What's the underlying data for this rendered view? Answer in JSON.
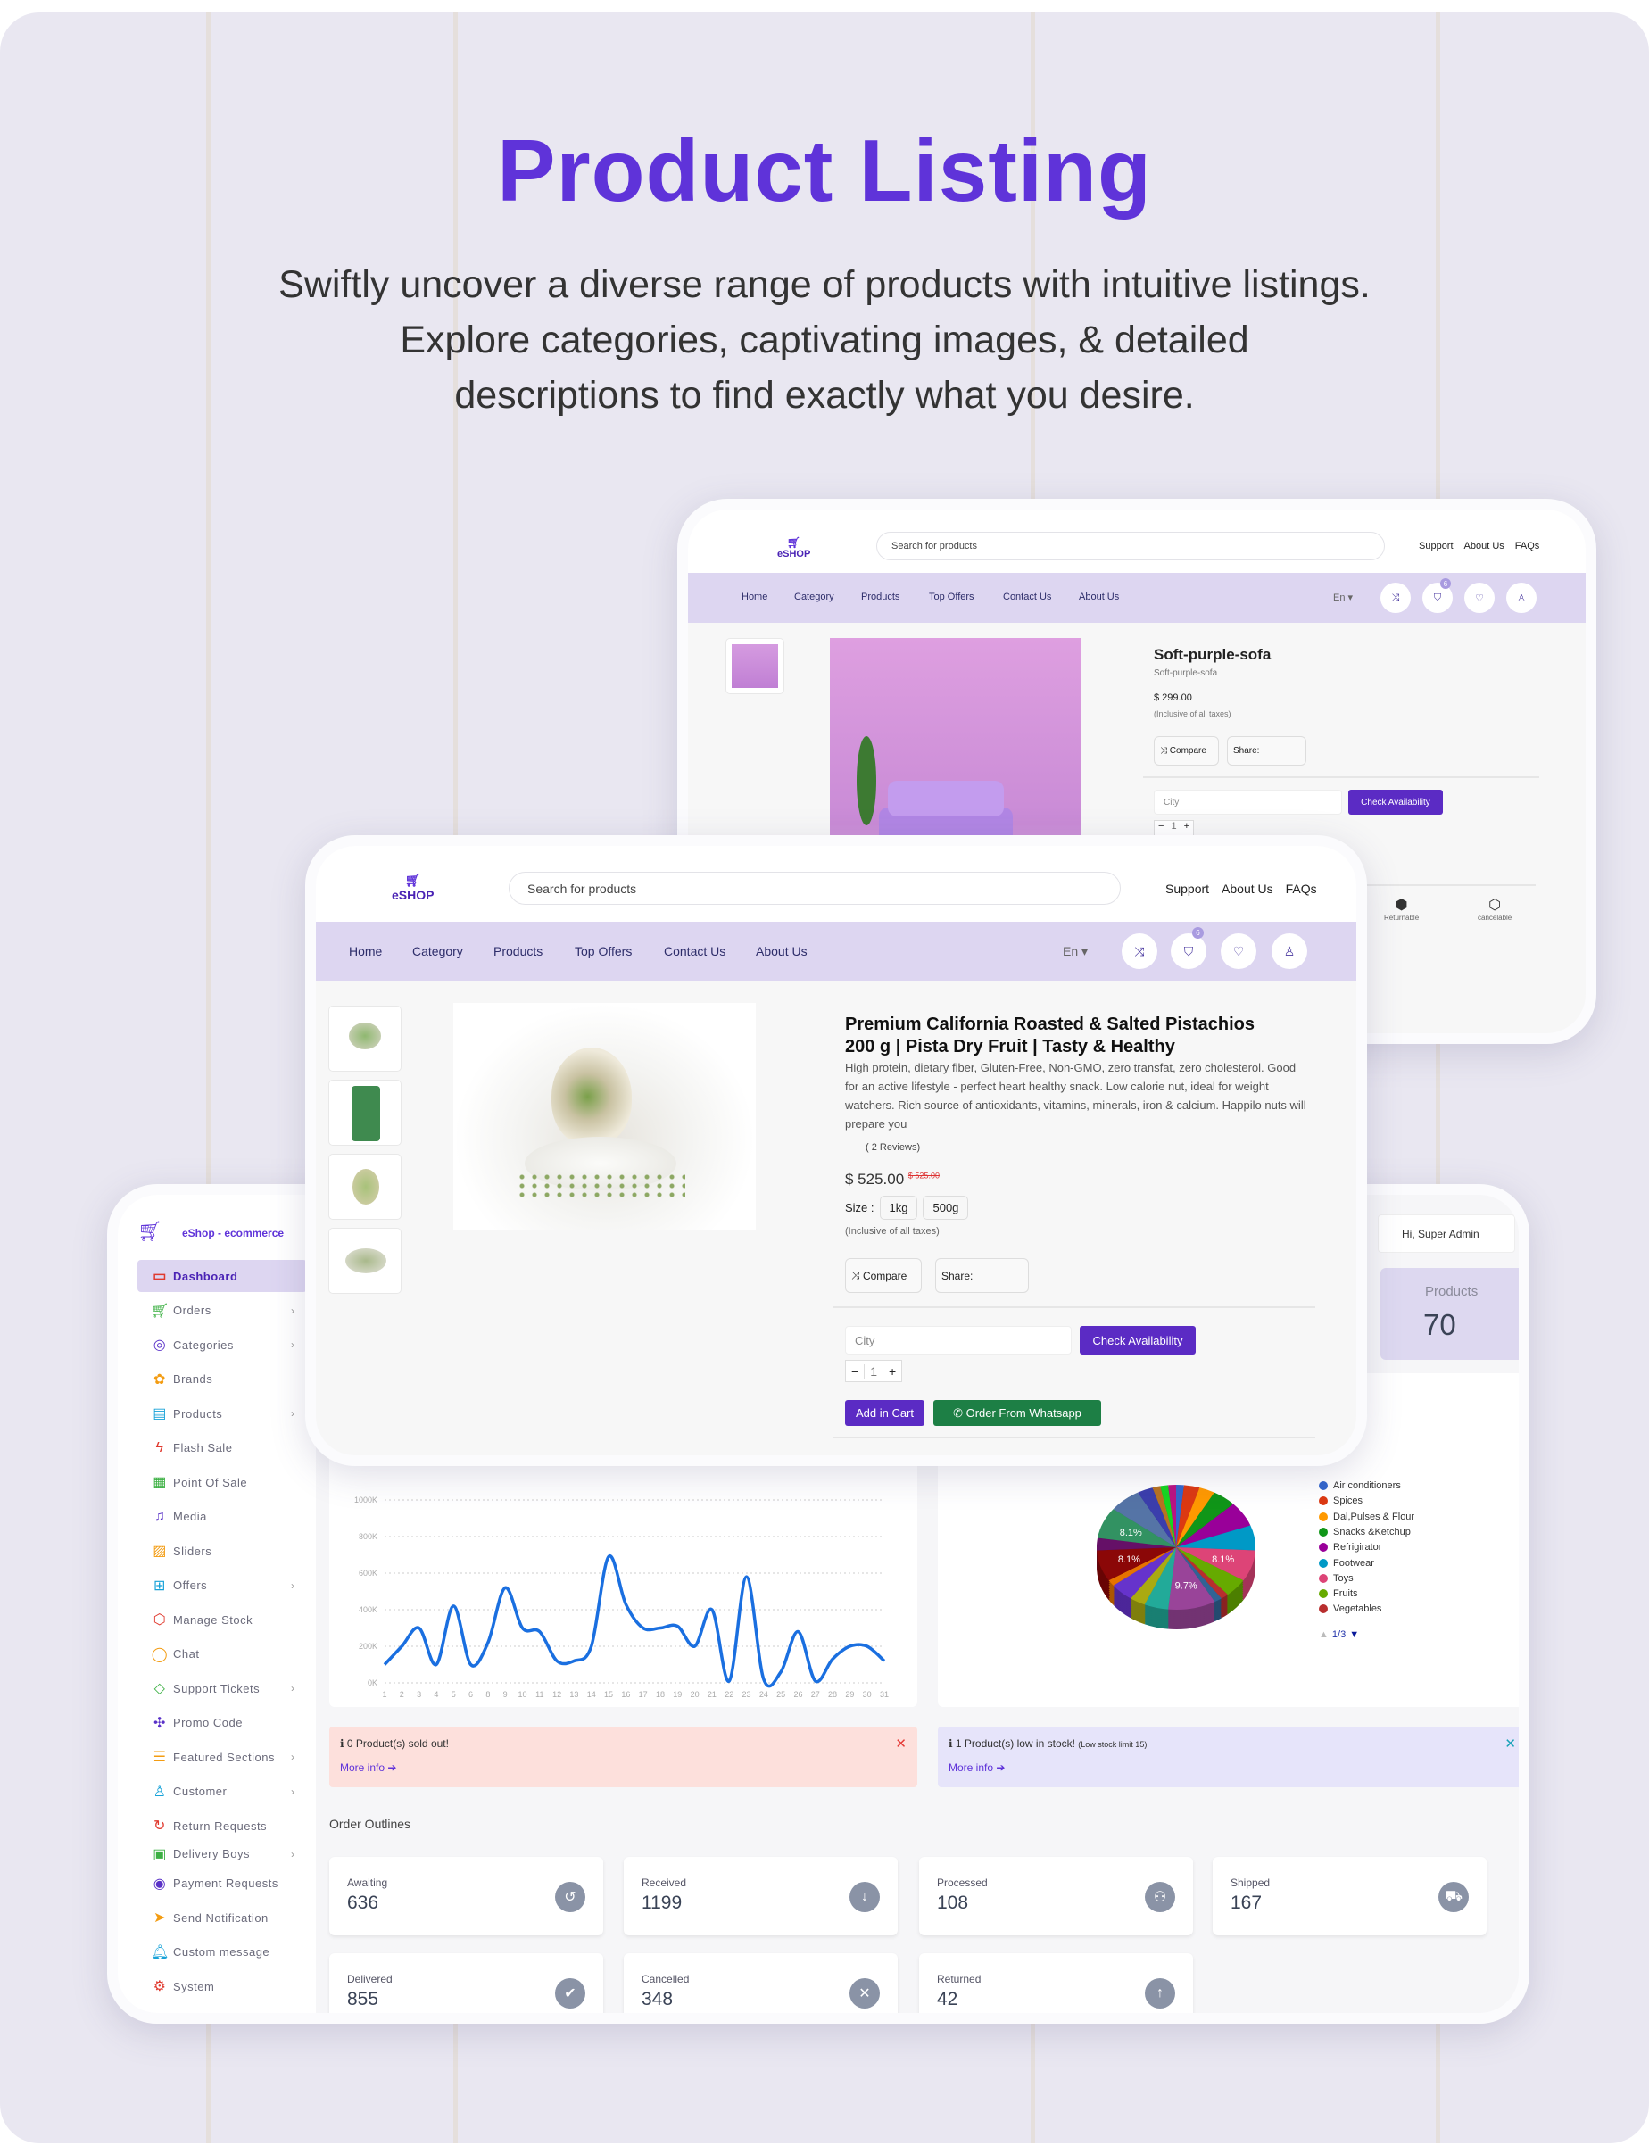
{
  "hero": {
    "title": "Product Listing",
    "subtitle_lines": [
      "Swiftly uncover a diverse range of products with intuitive listings.",
      "Explore categories, captivating images, & detailed",
      "descriptions to find exactly what you desire."
    ]
  },
  "colors": {
    "accent": "#5f33d9",
    "button": "#5b2bc4",
    "whatsapp": "#1d7f45",
    "nav_bg": "#ddd6f1",
    "chart_line": "#1a6fe0"
  },
  "storefront": {
    "logo": "eSHOP",
    "search_placeholder": "Search for products",
    "top_links": [
      "Support",
      "About Us",
      "FAQs"
    ],
    "nav": [
      "Home",
      "Category",
      "Products",
      "Top Offers",
      "Contact Us",
      "About Us"
    ],
    "language": "En ▾",
    "cart_count": "6",
    "icons": [
      "shuffle-icon",
      "bag-icon",
      "heart-icon",
      "user-icon"
    ]
  },
  "sofa_product": {
    "title": "Soft-purple-sofa",
    "subtitle": "Soft-purple-sofa",
    "price": "$ 299.00",
    "tax_note": "(Inclusive of all taxes)",
    "compare": "Compare",
    "share": "Share:",
    "city_placeholder": "City",
    "check": "Check Availability",
    "qty": "1",
    "features": [
      "Returnable",
      "cancelable"
    ]
  },
  "pista_product": {
    "title_line1": "Premium California Roasted & Salted Pistachios",
    "title_line2": "200 g | Pista Dry Fruit | Tasty & Healthy",
    "description": "High protein, dietary fiber, Gluten-Free, Non-GMO, zero transfat, zero cholesterol. Good for an active lifestyle - perfect heart healthy snack. Low calorie nut, ideal for weight watchers. Rich source of antioxidants, vitamins, minerals, iron & calcium. Happilo nuts will prepare you",
    "reviews": "( 2 Reviews)",
    "price": "$ 525.00",
    "old_price": "$ 525.00",
    "size_label": "Size :",
    "sizes": [
      "1kg",
      "500g"
    ],
    "tax_note": "(Inclusive of all taxes)",
    "compare": "Compare",
    "share": "Share:",
    "city_placeholder": "City",
    "check": "Check Availability",
    "qty": "1",
    "add_cart": "Add in Cart",
    "whatsapp": "Order From Whatsapp"
  },
  "admin": {
    "brand": "eShop - ecommerce",
    "greeting": "Hi, Super Admin",
    "products_label": "Products",
    "products_count": "70",
    "sidebar": [
      {
        "label": "Dashboard",
        "icon": "monitor-icon",
        "glyph": "▭",
        "color": "#e03a2f",
        "active": true
      },
      {
        "label": "Orders",
        "icon": "cart-icon",
        "glyph": "🛒︎",
        "color": "#3cb043",
        "chevron": true
      },
      {
        "label": "Categories",
        "icon": "target-icon",
        "glyph": "◎",
        "color": "#5a32c8",
        "chevron": true
      },
      {
        "label": "Brands",
        "icon": "brands-icon",
        "glyph": "✿",
        "color": "#f39c12"
      },
      {
        "label": "Products",
        "icon": "box-icon",
        "glyph": "▤",
        "color": "#17a2d8",
        "chevron": true
      },
      {
        "label": "Flash Sale",
        "icon": "flash-icon",
        "glyph": "ϟ",
        "color": "#e03a2f"
      },
      {
        "label": "Point Of Sale",
        "icon": "calculator-icon",
        "glyph": "▦",
        "color": "#3cb043"
      },
      {
        "label": "Media",
        "icon": "music-icon",
        "glyph": "♫",
        "color": "#5a32c8"
      },
      {
        "label": "Sliders",
        "icon": "image-icon",
        "glyph": "▨",
        "color": "#f39c12"
      },
      {
        "label": "Offers",
        "icon": "gift-icon",
        "glyph": "⊞",
        "color": "#17a2d8",
        "chevron": true
      },
      {
        "label": "Manage Stock",
        "icon": "cube-icon",
        "glyph": "⬡",
        "color": "#e03a2f"
      },
      {
        "label": "Chat",
        "icon": "chat-icon",
        "glyph": "◯",
        "color": "#f39c12"
      },
      {
        "label": "Support Tickets",
        "icon": "ticket-icon",
        "glyph": "◇",
        "color": "#3cb043",
        "chevron": true
      },
      {
        "label": "Promo Code",
        "icon": "puzzle-icon",
        "glyph": "✣",
        "color": "#5a32c8"
      },
      {
        "label": "Featured Sections",
        "icon": "layers-icon",
        "glyph": "☰",
        "color": "#f39c12",
        "chevron": true
      },
      {
        "label": "Customer",
        "icon": "user-icon",
        "glyph": "♙",
        "color": "#17a2d8",
        "chevron": true
      },
      {
        "label": "Return Requests",
        "icon": "return-icon",
        "glyph": "↻",
        "color": "#e03a2f"
      },
      {
        "label": "Delivery Boys",
        "icon": "delivery-icon",
        "glyph": "▣",
        "color": "#3cb043",
        "chevron": true,
        "clipped": true
      },
      {
        "label": "Payment Requests",
        "icon": "money-icon",
        "glyph": "◉",
        "color": "#5a32c8"
      },
      {
        "label": "Send Notification",
        "icon": "send-icon",
        "glyph": "➤",
        "color": "#f39c12"
      },
      {
        "label": "Custom message",
        "icon": "bell-icon",
        "glyph": "🔔︎",
        "color": "#17a2d8"
      },
      {
        "label": "System",
        "icon": "gear-icon",
        "glyph": "⚙",
        "color": "#e03a2f"
      }
    ],
    "alerts": {
      "sold_out": "0 Product(s) sold out!",
      "low_stock": "1 Product(s) low in stock!",
      "low_stock_note": "(Low stock limit 15)",
      "more_info": "More info"
    },
    "order_outlines_title": "Order Outlines",
    "order_stats": [
      {
        "label": "Awaiting",
        "value": "636",
        "icon": "history-icon",
        "glyph": "↺"
      },
      {
        "label": "Received",
        "value": "1199",
        "icon": "arrow-down-icon",
        "glyph": "↓"
      },
      {
        "label": "Processed",
        "value": "108",
        "icon": "people-icon",
        "glyph": "⚇"
      },
      {
        "label": "Shipped",
        "value": "167",
        "icon": "truck-icon",
        "glyph": "⛟"
      },
      {
        "label": "Delivered",
        "value": "855",
        "icon": "user-check-icon",
        "glyph": "✔"
      },
      {
        "label": "Cancelled",
        "value": "348",
        "icon": "x-circle-icon",
        "glyph": "✕"
      },
      {
        "label": "Returned",
        "value": "42",
        "icon": "arrow-up-icon",
        "glyph": "↑"
      }
    ]
  },
  "chart_data": [
    {
      "type": "line",
      "x": [
        "1",
        "2",
        "3",
        "4",
        "5",
        "6",
        "8",
        "9",
        "10",
        "11",
        "12",
        "13",
        "14",
        "15",
        "16",
        "17",
        "18",
        "19",
        "20",
        "21",
        "22",
        "23",
        "24",
        "25",
        "26",
        "27",
        "28",
        "29",
        "30",
        "31"
      ],
      "values": [
        100,
        200,
        300,
        100,
        420,
        100,
        220,
        520,
        300,
        280,
        120,
        120,
        200,
        690,
        430,
        300,
        300,
        310,
        200,
        400,
        10,
        580,
        20,
        60,
        280,
        10,
        130,
        200,
        200,
        120
      ],
      "yticks": [
        "0K",
        "200K",
        "400K",
        "600K",
        "800K",
        "1000K"
      ],
      "ylim": [
        0,
        1000
      ],
      "grid": true
    },
    {
      "type": "pie",
      "slices": [
        {
          "name": "Air conditioners",
          "value": 1.6,
          "color": "#3366cc"
        },
        {
          "name": "Spices",
          "value": 3.2,
          "color": "#dc3912"
        },
        {
          "name": "Dal,Pulses & Flour",
          "value": 3.2,
          "color": "#ff9900"
        },
        {
          "name": "Snacks &Ketchup",
          "value": 4.8,
          "color": "#109618"
        },
        {
          "name": "Refrigirator",
          "value": 6.5,
          "color": "#990099"
        },
        {
          "name": "Footwear",
          "value": 6.5,
          "color": "#0099c6"
        },
        {
          "name": "Toys",
          "value": 8.1,
          "color": "#dd4477",
          "label": "8.1%"
        },
        {
          "name": "Fruits",
          "value": 4.8,
          "color": "#66aa00"
        },
        {
          "name": "Vegetables",
          "value": 1.6,
          "color": "#b82e2e"
        },
        {
          "value": 1.6,
          "color": "#316395"
        },
        {
          "value": 9.7,
          "color": "#994499",
          "label": "9.7%"
        },
        {
          "value": 4.9,
          "color": "#22aa99"
        },
        {
          "value": 3.2,
          "color": "#aaaa11"
        },
        {
          "value": 4.8,
          "color": "#6633cc"
        },
        {
          "value": 1.6,
          "color": "#e67300"
        },
        {
          "value": 8.1,
          "color": "#8b0707",
          "label": "8.1%"
        },
        {
          "value": 3.2,
          "color": "#651067"
        },
        {
          "value": 8.1,
          "color": "#329262",
          "label": "8.1%"
        },
        {
          "value": 6.5,
          "color": "#5574a6"
        },
        {
          "value": 3.2,
          "color": "#3b3eac"
        },
        {
          "value": 1.6,
          "color": "#b77322"
        },
        {
          "value": 1.6,
          "color": "#16d620"
        },
        {
          "value": 1.6,
          "color": "#b91383"
        }
      ],
      "legend_page": "1/3",
      "legend_placement": "right"
    }
  ]
}
